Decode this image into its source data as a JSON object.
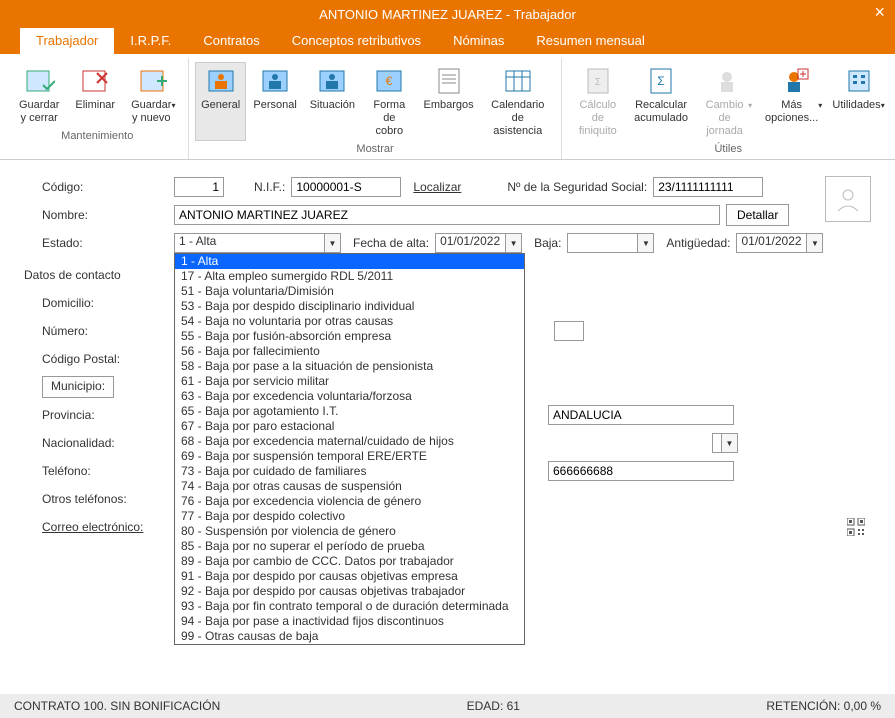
{
  "title": "ANTONIO MARTINEZ JUAREZ - Trabajador",
  "tabs": [
    "Trabajador",
    "I.R.P.F.",
    "Contratos",
    "Conceptos retributivos",
    "Nóminas",
    "Resumen mensual"
  ],
  "ribbon": {
    "groups": [
      {
        "title": "Mantenimiento",
        "items": [
          {
            "label": "Guardar\ny cerrar"
          },
          {
            "label": "Eliminar"
          },
          {
            "label": "Guardar\ny nuevo",
            "drop": true
          }
        ]
      },
      {
        "title": "Mostrar",
        "items": [
          {
            "label": "General",
            "active": true
          },
          {
            "label": "Personal"
          },
          {
            "label": "Situación"
          },
          {
            "label": "Forma\nde cobro"
          },
          {
            "label": "Embargos"
          },
          {
            "label": "Calendario\nde asistencia"
          }
        ]
      },
      {
        "title": "Útiles",
        "items": [
          {
            "label": "Cálculo de\nfiniquito",
            "disabled": true
          },
          {
            "label": "Recalcular\nacumulado"
          },
          {
            "label": "Cambio de\njornada",
            "drop": true,
            "disabled": true
          },
          {
            "label": "Más\nopciones...",
            "drop": true
          },
          {
            "label": "Utilidades",
            "drop": true
          }
        ]
      }
    ]
  },
  "labels": {
    "codigo": "Código:",
    "nif": "N.I.F.:",
    "localizar": "Localizar",
    "nss": "Nº de la Seguridad Social:",
    "nombre": "Nombre:",
    "detallar": "Detallar",
    "estado": "Estado:",
    "fecha_alta": "Fecha de alta:",
    "baja": "Baja:",
    "antiguedad": "Antigüedad:",
    "datos_contacto": "Datos de contacto",
    "domicilio": "Domicilio:",
    "numero": "Número:",
    "cp": "Código Postal:",
    "municipio": "Municipio:",
    "provincia": "Provincia:",
    "nacionalidad": "Nacionalidad:",
    "telefono": "Teléfono:",
    "otros_telefonos": "Otros teléfonos:",
    "correo": "Correo electrónico:"
  },
  "values": {
    "codigo": "1",
    "nif": "10000001-S",
    "nss": "23/1111111111",
    "nombre": "ANTONIO MARTINEZ JUAREZ",
    "estado": "1 - Alta",
    "fecha_alta": "01/01/2022",
    "baja": "",
    "antiguedad": "01/01/2022",
    "provincia": "ANDALUCIA",
    "telefono2": "666666688"
  },
  "estado_options": [
    "1 - Alta",
    "17 - Alta empleo sumergido RDL 5/2011",
    "51 - Baja voluntaria/Dimisión",
    "53 - Baja por despido disciplinario individual",
    "54 - Baja no voluntaria por otras causas",
    "55 - Baja por fusión-absorción empresa",
    "56 - Baja por fallecimiento",
    "58 - Baja por pase a la situación de pensionista",
    "61 - Baja por servicio militar",
    "63 - Baja por excedencia voluntaria/forzosa",
    "65 - Baja por agotamiento I.T.",
    "67 - Baja por paro estacional",
    "68 - Baja por excedencia maternal/cuidado de hijos",
    "69 - Baja por suspensión temporal ERE/ERTE",
    "73 - Baja por cuidado de familiares",
    "74 - Baja por otras causas de suspensión",
    "76 - Baja por excedencia violencia de género",
    "77 - Baja por despido colectivo",
    "80 - Suspensión por violencia de género",
    "85 - Baja por no superar el período de prueba",
    "89 - Baja por cambio de CCC. Datos por trabajador",
    "91 - Baja por despido por causas objetivas empresa",
    "92 - Baja por despido por causas objetivas trabajador",
    "93 - Baja por fin contrato temporal o de duración determinada",
    "94 - Baja por pase a inactividad fijos discontinuos",
    "99 - Otras causas de baja"
  ],
  "status": {
    "contrato": "CONTRATO 100.  SIN BONIFICACIÓN",
    "edad": "EDAD: 61",
    "retencion": "RETENCIÓN: 0,00 %"
  }
}
